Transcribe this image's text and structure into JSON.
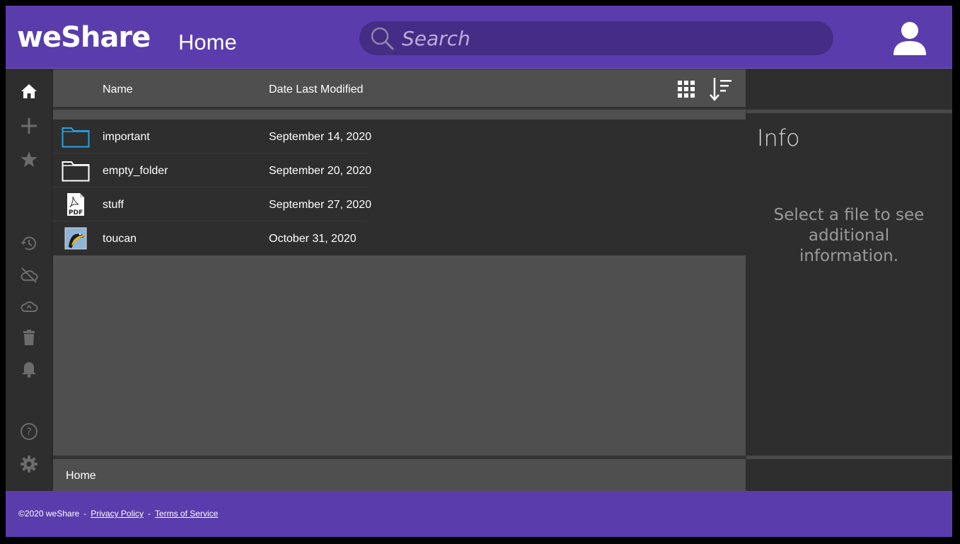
{
  "app": {
    "logo": "weShare",
    "page_title": "Home"
  },
  "search": {
    "placeholder": "Search"
  },
  "rail": {
    "items": [
      {
        "name": "home-icon",
        "active": true
      },
      {
        "name": "add-icon"
      },
      {
        "name": "star-icon"
      },
      {
        "name": "history-icon"
      },
      {
        "name": "cloud-off-icon"
      },
      {
        "name": "cloud-recycle-icon"
      },
      {
        "name": "trash-icon"
      },
      {
        "name": "bell-icon"
      },
      {
        "name": "help-icon"
      },
      {
        "name": "gear-icon"
      }
    ]
  },
  "columns": {
    "name": "Name",
    "date": "Date Last Modified"
  },
  "files": [
    {
      "name": "important",
      "date": "September 14, 2020",
      "icon": "folder-icon-highlight"
    },
    {
      "name": "empty_folder",
      "date": "September 20, 2020",
      "icon": "folder-icon"
    },
    {
      "name": "stuff",
      "date": "September 27, 2020",
      "icon": "pdf-file-icon"
    },
    {
      "name": "toucan",
      "date": "October 31, 2020",
      "icon": "image-file-icon"
    }
  ],
  "status": {
    "path": "Home"
  },
  "info": {
    "title": "Info",
    "message": "Select a file to see additional information."
  },
  "footer": {
    "copyright": "©2020 weShare",
    "privacy": "Privacy Policy",
    "terms": "Terms of Service"
  },
  "colors": {
    "brand": "#5a3cad",
    "search_bg": "#452c85",
    "folder_highlight": "#29a3e0"
  }
}
